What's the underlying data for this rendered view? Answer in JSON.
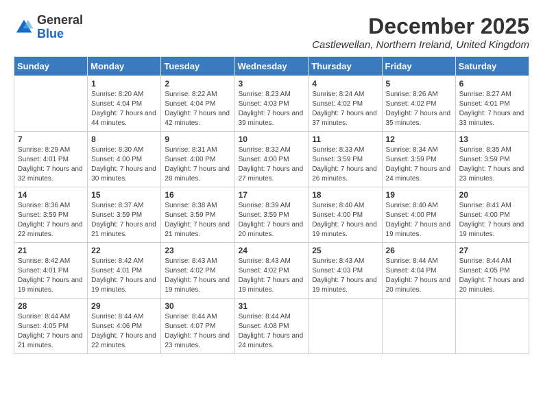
{
  "logo": {
    "general": "General",
    "blue": "Blue"
  },
  "header": {
    "month": "December 2025",
    "subtitle": "Castlewellan, Northern Ireland, United Kingdom"
  },
  "days_of_week": [
    "Sunday",
    "Monday",
    "Tuesday",
    "Wednesday",
    "Thursday",
    "Friday",
    "Saturday"
  ],
  "weeks": [
    [
      {
        "day": "",
        "sunrise": "",
        "sunset": "",
        "daylight": ""
      },
      {
        "day": "1",
        "sunrise": "Sunrise: 8:20 AM",
        "sunset": "Sunset: 4:04 PM",
        "daylight": "Daylight: 7 hours and 44 minutes."
      },
      {
        "day": "2",
        "sunrise": "Sunrise: 8:22 AM",
        "sunset": "Sunset: 4:04 PM",
        "daylight": "Daylight: 7 hours and 42 minutes."
      },
      {
        "day": "3",
        "sunrise": "Sunrise: 8:23 AM",
        "sunset": "Sunset: 4:03 PM",
        "daylight": "Daylight: 7 hours and 39 minutes."
      },
      {
        "day": "4",
        "sunrise": "Sunrise: 8:24 AM",
        "sunset": "Sunset: 4:02 PM",
        "daylight": "Daylight: 7 hours and 37 minutes."
      },
      {
        "day": "5",
        "sunrise": "Sunrise: 8:26 AM",
        "sunset": "Sunset: 4:02 PM",
        "daylight": "Daylight: 7 hours and 35 minutes."
      },
      {
        "day": "6",
        "sunrise": "Sunrise: 8:27 AM",
        "sunset": "Sunset: 4:01 PM",
        "daylight": "Daylight: 7 hours and 33 minutes."
      }
    ],
    [
      {
        "day": "7",
        "sunrise": "Sunrise: 8:29 AM",
        "sunset": "Sunset: 4:01 PM",
        "daylight": "Daylight: 7 hours and 32 minutes."
      },
      {
        "day": "8",
        "sunrise": "Sunrise: 8:30 AM",
        "sunset": "Sunset: 4:00 PM",
        "daylight": "Daylight: 7 hours and 30 minutes."
      },
      {
        "day": "9",
        "sunrise": "Sunrise: 8:31 AM",
        "sunset": "Sunset: 4:00 PM",
        "daylight": "Daylight: 7 hours and 28 minutes."
      },
      {
        "day": "10",
        "sunrise": "Sunrise: 8:32 AM",
        "sunset": "Sunset: 4:00 PM",
        "daylight": "Daylight: 7 hours and 27 minutes."
      },
      {
        "day": "11",
        "sunrise": "Sunrise: 8:33 AM",
        "sunset": "Sunset: 3:59 PM",
        "daylight": "Daylight: 7 hours and 26 minutes."
      },
      {
        "day": "12",
        "sunrise": "Sunrise: 8:34 AM",
        "sunset": "Sunset: 3:59 PM",
        "daylight": "Daylight: 7 hours and 24 minutes."
      },
      {
        "day": "13",
        "sunrise": "Sunrise: 8:35 AM",
        "sunset": "Sunset: 3:59 PM",
        "daylight": "Daylight: 7 hours and 23 minutes."
      }
    ],
    [
      {
        "day": "14",
        "sunrise": "Sunrise: 8:36 AM",
        "sunset": "Sunset: 3:59 PM",
        "daylight": "Daylight: 7 hours and 22 minutes."
      },
      {
        "day": "15",
        "sunrise": "Sunrise: 8:37 AM",
        "sunset": "Sunset: 3:59 PM",
        "daylight": "Daylight: 7 hours and 21 minutes."
      },
      {
        "day": "16",
        "sunrise": "Sunrise: 8:38 AM",
        "sunset": "Sunset: 3:59 PM",
        "daylight": "Daylight: 7 hours and 21 minutes."
      },
      {
        "day": "17",
        "sunrise": "Sunrise: 8:39 AM",
        "sunset": "Sunset: 3:59 PM",
        "daylight": "Daylight: 7 hours and 20 minutes."
      },
      {
        "day": "18",
        "sunrise": "Sunrise: 8:40 AM",
        "sunset": "Sunset: 4:00 PM",
        "daylight": "Daylight: 7 hours and 19 minutes."
      },
      {
        "day": "19",
        "sunrise": "Sunrise: 8:40 AM",
        "sunset": "Sunset: 4:00 PM",
        "daylight": "Daylight: 7 hours and 19 minutes."
      },
      {
        "day": "20",
        "sunrise": "Sunrise: 8:41 AM",
        "sunset": "Sunset: 4:00 PM",
        "daylight": "Daylight: 7 hours and 19 minutes."
      }
    ],
    [
      {
        "day": "21",
        "sunrise": "Sunrise: 8:42 AM",
        "sunset": "Sunset: 4:01 PM",
        "daylight": "Daylight: 7 hours and 19 minutes."
      },
      {
        "day": "22",
        "sunrise": "Sunrise: 8:42 AM",
        "sunset": "Sunset: 4:01 PM",
        "daylight": "Daylight: 7 hours and 19 minutes."
      },
      {
        "day": "23",
        "sunrise": "Sunrise: 8:43 AM",
        "sunset": "Sunset: 4:02 PM",
        "daylight": "Daylight: 7 hours and 19 minutes."
      },
      {
        "day": "24",
        "sunrise": "Sunrise: 8:43 AM",
        "sunset": "Sunset: 4:02 PM",
        "daylight": "Daylight: 7 hours and 19 minutes."
      },
      {
        "day": "25",
        "sunrise": "Sunrise: 8:43 AM",
        "sunset": "Sunset: 4:03 PM",
        "daylight": "Daylight: 7 hours and 19 minutes."
      },
      {
        "day": "26",
        "sunrise": "Sunrise: 8:44 AM",
        "sunset": "Sunset: 4:04 PM",
        "daylight": "Daylight: 7 hours and 20 minutes."
      },
      {
        "day": "27",
        "sunrise": "Sunrise: 8:44 AM",
        "sunset": "Sunset: 4:05 PM",
        "daylight": "Daylight: 7 hours and 20 minutes."
      }
    ],
    [
      {
        "day": "28",
        "sunrise": "Sunrise: 8:44 AM",
        "sunset": "Sunset: 4:05 PM",
        "daylight": "Daylight: 7 hours and 21 minutes."
      },
      {
        "day": "29",
        "sunrise": "Sunrise: 8:44 AM",
        "sunset": "Sunset: 4:06 PM",
        "daylight": "Daylight: 7 hours and 22 minutes."
      },
      {
        "day": "30",
        "sunrise": "Sunrise: 8:44 AM",
        "sunset": "Sunset: 4:07 PM",
        "daylight": "Daylight: 7 hours and 23 minutes."
      },
      {
        "day": "31",
        "sunrise": "Sunrise: 8:44 AM",
        "sunset": "Sunset: 4:08 PM",
        "daylight": "Daylight: 7 hours and 24 minutes."
      },
      {
        "day": "",
        "sunrise": "",
        "sunset": "",
        "daylight": ""
      },
      {
        "day": "",
        "sunrise": "",
        "sunset": "",
        "daylight": ""
      },
      {
        "day": "",
        "sunrise": "",
        "sunset": "",
        "daylight": ""
      }
    ]
  ]
}
